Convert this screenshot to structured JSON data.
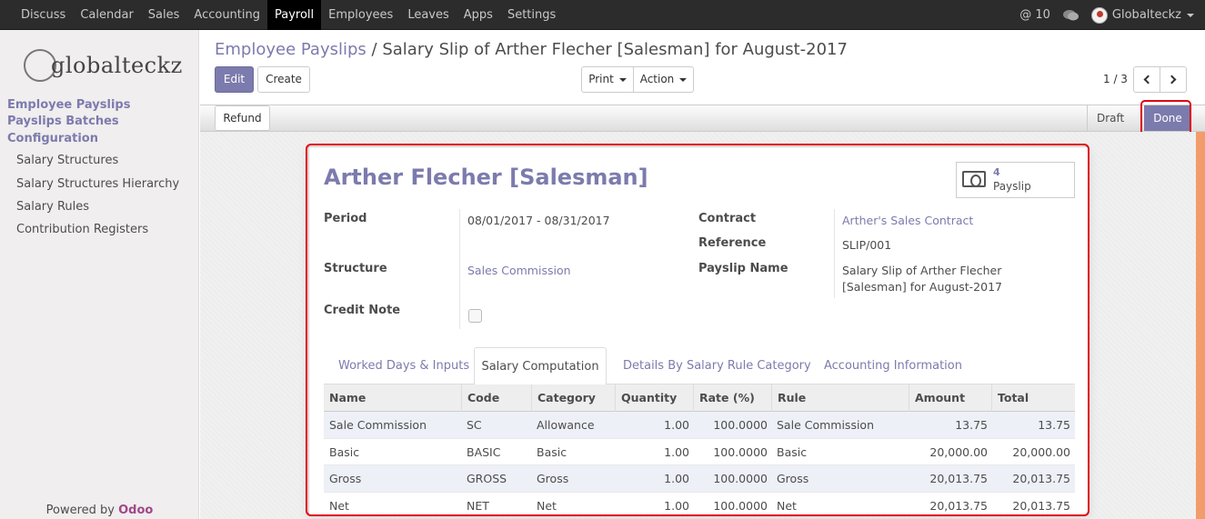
{
  "topbar": {
    "menu": [
      "Discuss",
      "Calendar",
      "Sales",
      "Accounting",
      "Payroll",
      "Employees",
      "Leaves",
      "Apps",
      "Settings"
    ],
    "active_index": 4,
    "mentions": "@ 10",
    "user": "Globalteckz"
  },
  "sidebar": {
    "logo": "globalteckz",
    "sections": [
      "Employee Payslips",
      "Payslips Batches",
      "Configuration"
    ],
    "items": [
      "Salary Structures",
      "Salary Structures Hierarchy",
      "Salary Rules",
      "Contribution Registers"
    ],
    "powered_by": "Powered by",
    "brand": "Odoo"
  },
  "control": {
    "breadcrumb_link": "Employee Payslips",
    "breadcrumb_sep": "/",
    "breadcrumb_current": "Salary Slip of Arther Flecher [Salesman] for August-2017",
    "edit": "Edit",
    "create": "Create",
    "print": "Print",
    "action": "Action",
    "pager": "1 / 3"
  },
  "status": {
    "refund": "Refund",
    "draft": "Draft",
    "done": "Done"
  },
  "form": {
    "employee": "Arther Flecher [Salesman]",
    "smart_count": "4",
    "smart_label": "Payslip",
    "period_label": "Period",
    "period": "08/01/2017 - 08/31/2017",
    "structure_label": "Structure",
    "structure": "Sales Commission",
    "credit_note_label": "Credit Note",
    "contract_label": "Contract",
    "contract": "Arther's Sales Contract",
    "reference_label": "Reference",
    "reference": "SLIP/001",
    "payslip_name_label": "Payslip Name",
    "payslip_name_1": "Salary Slip of Arther Flecher",
    "payslip_name_2": "[Salesman] for August-2017"
  },
  "tabs": [
    "Worked Days & Inputs",
    "Salary Computation",
    "Details By Salary Rule Category",
    "Accounting Information"
  ],
  "table": {
    "headers": [
      "Name",
      "Code",
      "Category",
      "Quantity",
      "Rate (%)",
      "Rule",
      "Amount",
      "Total"
    ],
    "rows": [
      [
        "Sale Commission",
        "SC",
        "Allowance",
        "1.00",
        "100.0000",
        "Sale Commission",
        "13.75",
        "13.75"
      ],
      [
        "Basic",
        "BASIC",
        "Basic",
        "1.00",
        "100.0000",
        "Basic",
        "20,000.00",
        "20,000.00"
      ],
      [
        "Gross",
        "GROSS",
        "Gross",
        "1.00",
        "100.0000",
        "Gross",
        "20,013.75",
        "20,013.75"
      ],
      [
        "Net",
        "NET",
        "Net",
        "1.00",
        "100.0000",
        "Net",
        "20,013.75",
        "20,013.75"
      ]
    ]
  },
  "colors": {
    "accent": "#7c7bad",
    "highlight": "#e0000e"
  }
}
